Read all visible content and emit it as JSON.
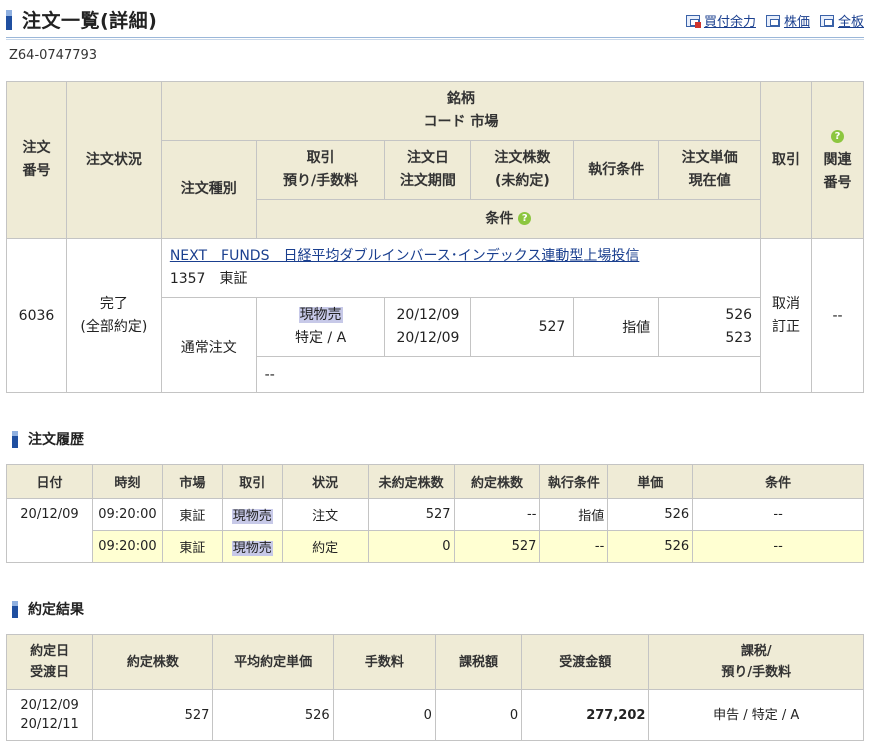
{
  "header": {
    "title": "注文一覧(詳細)",
    "links": [
      {
        "label": "買付余力",
        "icon": "buying-power-icon"
      },
      {
        "label": "株価",
        "icon": "window-icon"
      },
      {
        "label": "全板",
        "icon": "window-icon"
      }
    ],
    "account_id": "Z64-0747793"
  },
  "order_table": {
    "headers": {
      "order_no": [
        "注文",
        "番号"
      ],
      "status": "注文状況",
      "issue": [
        "銘柄",
        "コード  市場"
      ],
      "order_type": "注文種別",
      "trade": [
        "取引",
        "預り/手数料"
      ],
      "order_date": [
        "注文日",
        "注文期間"
      ],
      "quantity": [
        "注文株数",
        "(未約定)"
      ],
      "exec_cond": "執行条件",
      "price": [
        "注文単価",
        "現在値"
      ],
      "action": "取引",
      "condition": "条件",
      "related": [
        "関連",
        "番号"
      ]
    },
    "row": {
      "order_no": "6036",
      "status": [
        "完了",
        "(全部約定)"
      ],
      "issue_name": "NEXT　FUNDS　日経平均ダブルインバース･インデックス連動型上場投信",
      "issue_code_market": "1357　東証",
      "order_type": "通常注文",
      "trade": "現物売",
      "custody": "特定 / A",
      "order_date": "20/12/09",
      "order_period": "20/12/09",
      "quantity": "527",
      "exec_cond": "指値",
      "order_price": "526",
      "current_price": "523",
      "actions": [
        "取消",
        "訂正"
      ],
      "related": "--",
      "condition": "--"
    }
  },
  "history": {
    "title": "注文履歴",
    "headers": [
      "日付",
      "時刻",
      "市場",
      "取引",
      "状況",
      "未約定株数",
      "約定株数",
      "執行条件",
      "単価",
      "条件"
    ],
    "date": "20/12/09",
    "rows": [
      {
        "time": "09:20:00",
        "market": "東証",
        "trade": "現物売",
        "status": "注文",
        "unfilled": "527",
        "filled": "--",
        "exec": "指値",
        "price": "526",
        "cond": "--"
      },
      {
        "time": "09:20:00",
        "market": "東証",
        "trade": "現物売",
        "status": "約定",
        "unfilled": "0",
        "filled": "527",
        "exec": "--",
        "price": "526",
        "cond": "--"
      }
    ]
  },
  "results": {
    "title": "約定結果",
    "headers": {
      "dates": [
        "約定日",
        "受渡日"
      ],
      "qty": "約定株数",
      "avg_price": "平均約定単価",
      "fee": "手数料",
      "tax": "課税額",
      "amount": "受渡金額",
      "tax_custody": [
        "課税/",
        "預り/手数料"
      ]
    },
    "row": {
      "exec_date": "20/12/09",
      "settle_date": "20/12/11",
      "qty": "527",
      "avg_price": "526",
      "fee": "0",
      "tax": "0",
      "amount": "277,202",
      "tax_custody": "申告 / 特定 / A"
    }
  }
}
